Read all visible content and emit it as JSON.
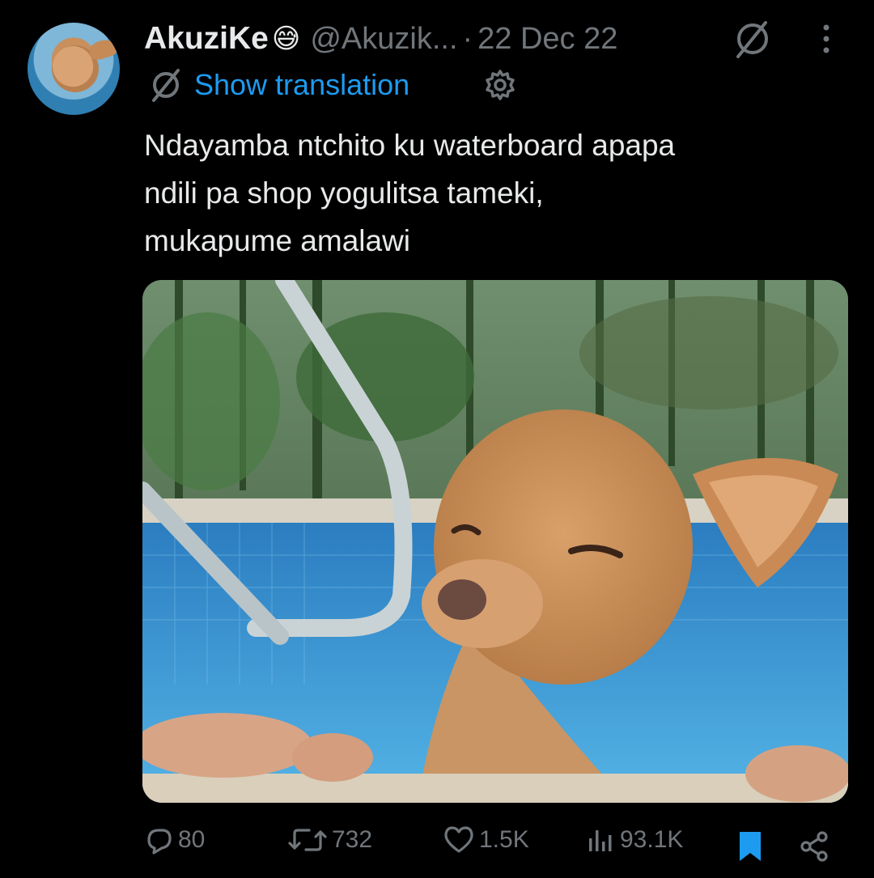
{
  "author": {
    "display_name": "AkuziKe",
    "emoji": "😅",
    "handle": "@Akuzik...",
    "separator": "·",
    "date": "22 Dec 22"
  },
  "translation": {
    "label": "Show translation"
  },
  "tweet": {
    "text_lines": [
      "Ndayamba ntchito ku waterboard apapa",
      "ndili pa shop yogulitsa tameki,",
      "mukapume amalawi"
    ]
  },
  "media": {
    "description": "photo"
  },
  "actions": {
    "replies": "80",
    "retweets": "732",
    "likes": "1.5K",
    "views": "93.1K"
  },
  "colors": {
    "background": "#000000",
    "text": "#e7e9ea",
    "muted": "#71767b",
    "accent": "#1d9bf0"
  },
  "icons": {
    "grok": "grok-icon",
    "more": "more-icon",
    "translate": "translate-icon",
    "settings": "gear-icon",
    "reply": "reply-icon",
    "retweet": "retweet-icon",
    "like": "heart-icon",
    "views": "views-icon",
    "bookmark": "bookmark-icon",
    "share": "share-icon"
  }
}
